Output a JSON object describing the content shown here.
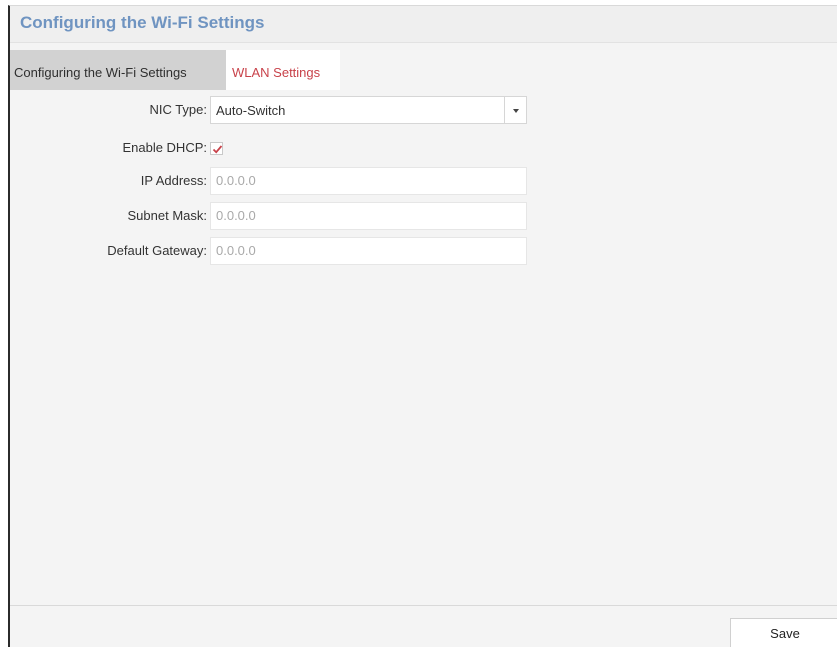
{
  "header": {
    "title": "Configuring the Wi-Fi Settings"
  },
  "tabs": [
    {
      "label": "Configuring the Wi-Fi Settings",
      "active": false
    },
    {
      "label": "WLAN Settings",
      "active": true
    }
  ],
  "form": {
    "nic_type": {
      "label": "NIC Type:",
      "value": "Auto-Switch"
    },
    "enable_dhcp": {
      "label": "Enable DHCP:",
      "checked": true
    },
    "ip_address": {
      "label": "IP Address:",
      "value": "0.0.0.0"
    },
    "subnet_mask": {
      "label": "Subnet Mask:",
      "value": "0.0.0.0"
    },
    "default_gateway": {
      "label": "Default Gateway:",
      "value": "0.0.0.0"
    }
  },
  "footer": {
    "save_label": "Save"
  },
  "colors": {
    "title": "#6f94c1",
    "active_tab_text": "#c8424a",
    "checkmark": "#c8424a",
    "background": "#f4f4f4"
  },
  "icons": {
    "dropdown": "chevron-down-icon",
    "checkbox": "checkmark-icon"
  }
}
